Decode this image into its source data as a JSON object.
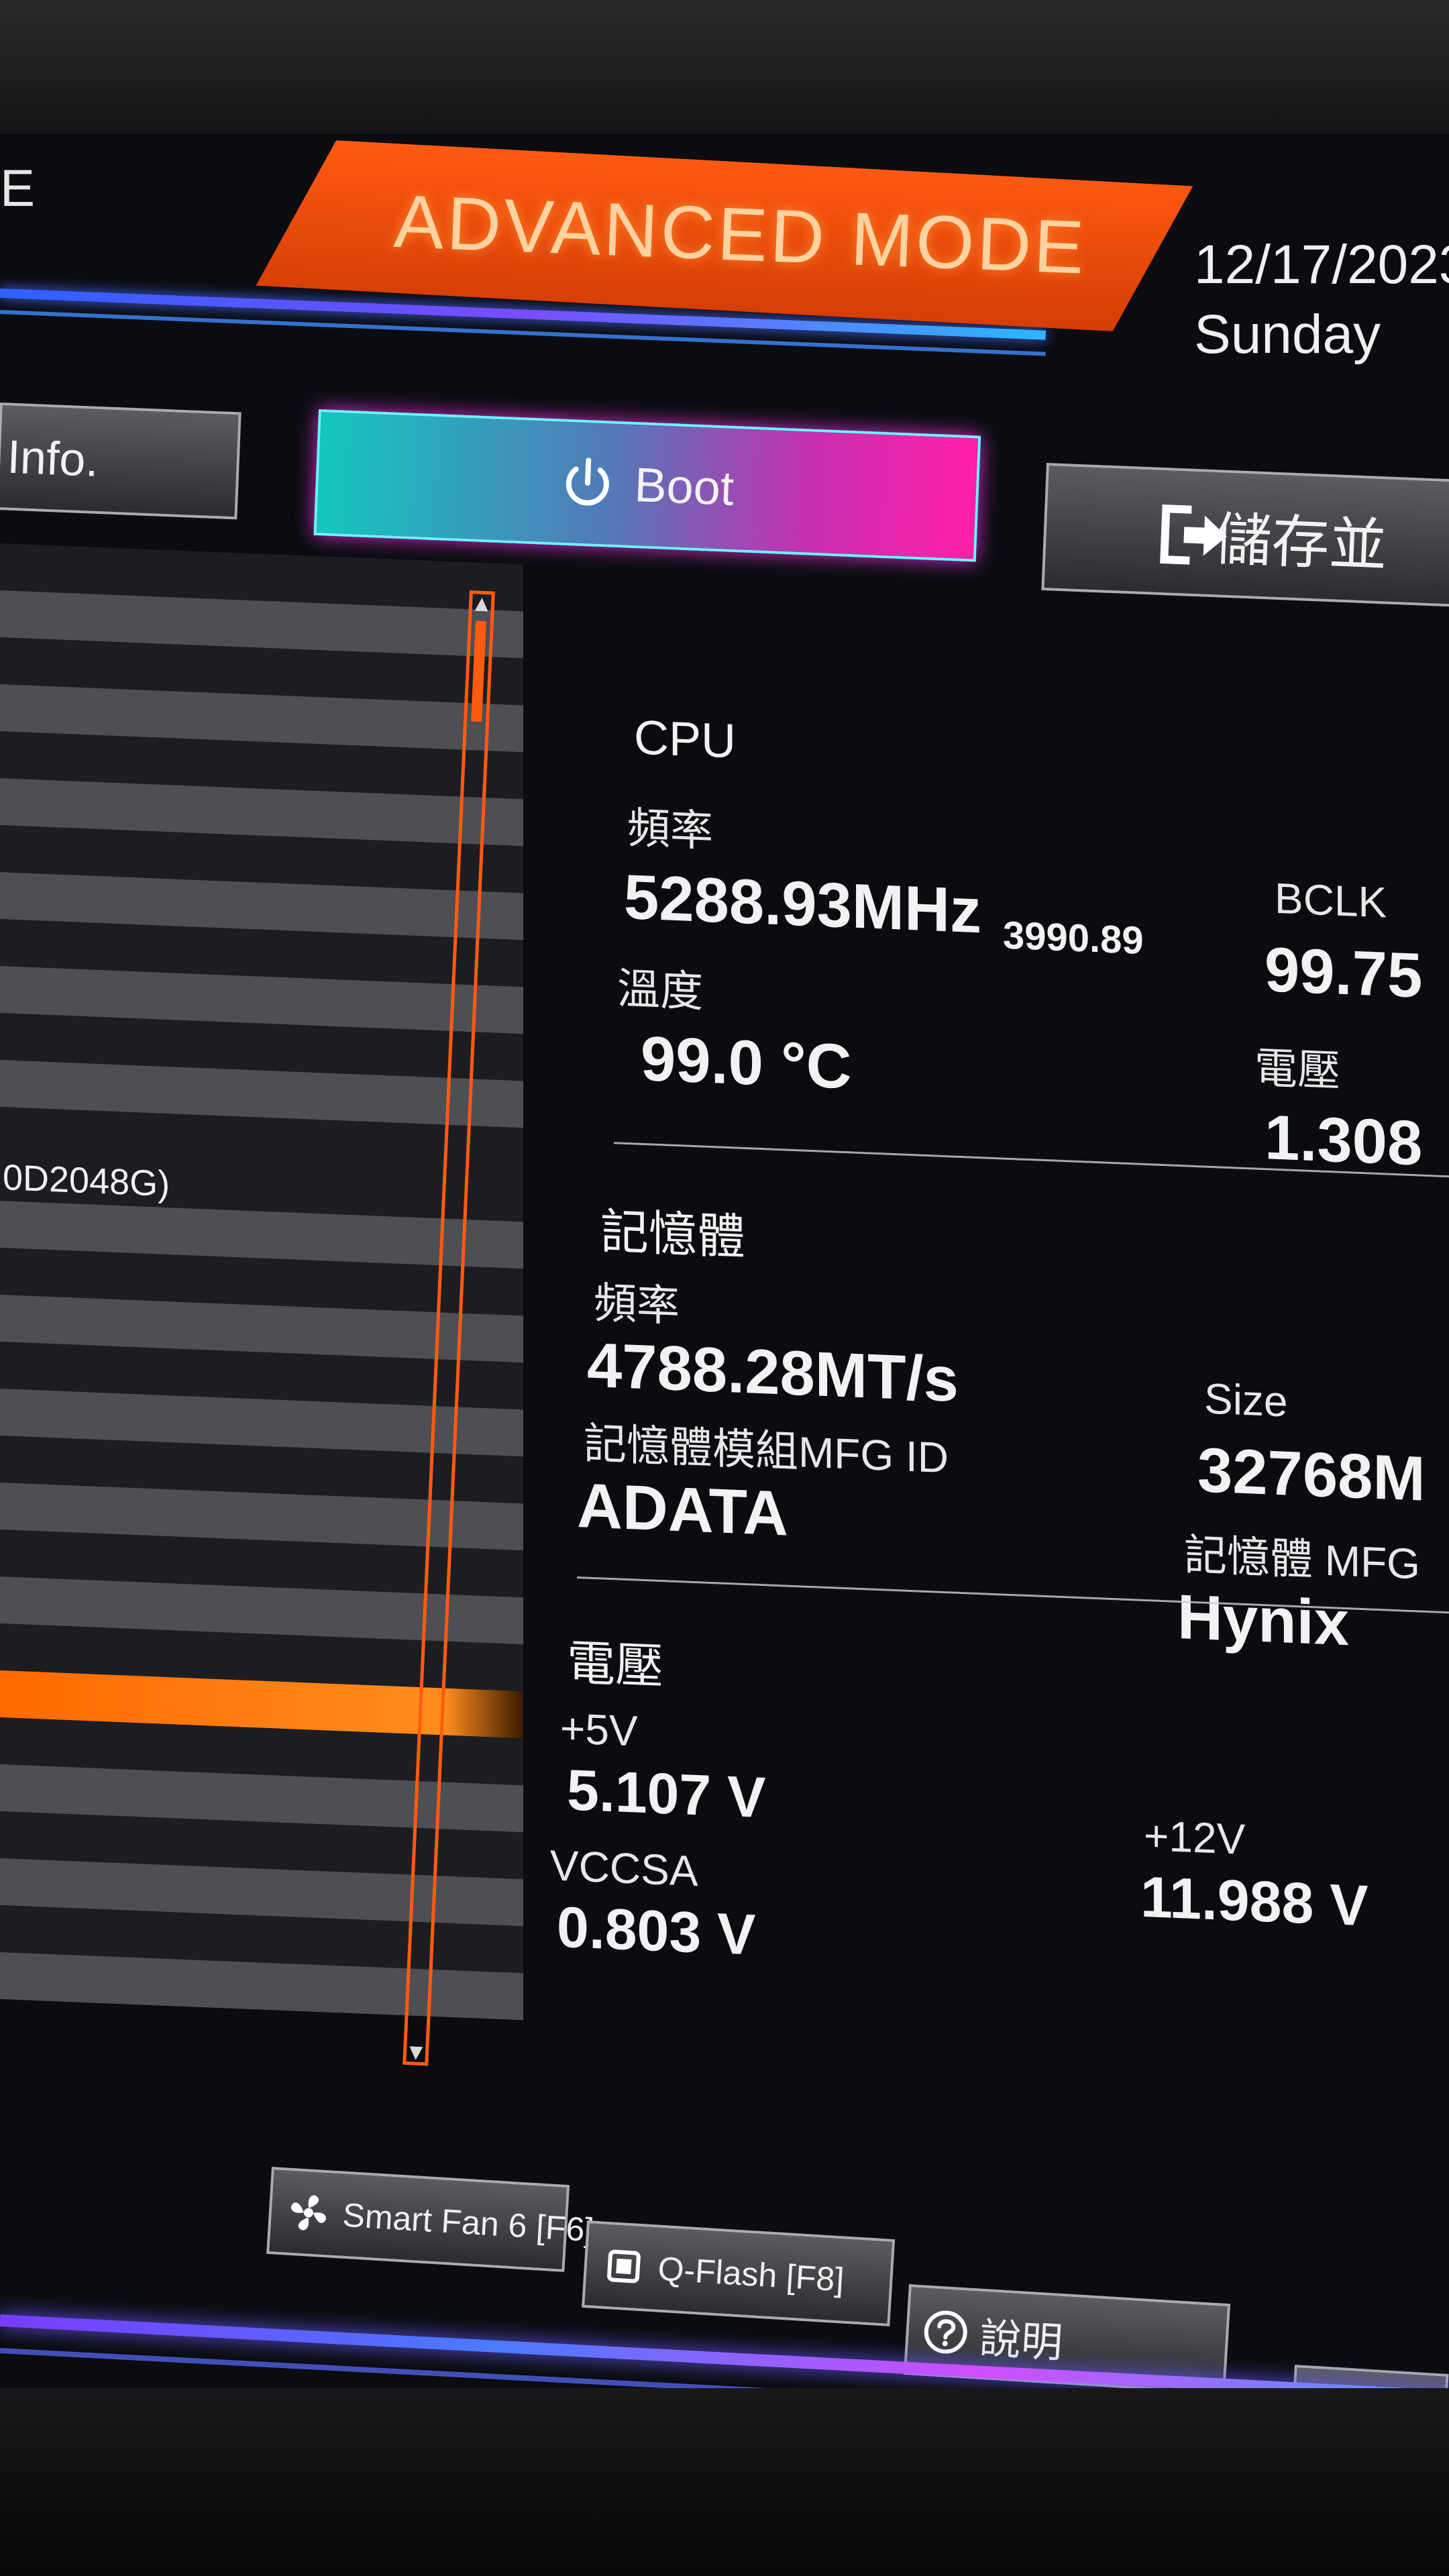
{
  "header": {
    "mode_letter": "E",
    "mode_title": "ADVANCED MODE",
    "date": "12/17/2023",
    "weekday": "Sunday"
  },
  "tabs": {
    "info": "Info.",
    "boot": "Boot",
    "save_exit": "儲存並"
  },
  "list": {
    "visible_item": "0D2048G)"
  },
  "cpu": {
    "heading": "CPU",
    "freq_label": "頻率",
    "freq_value": "5288.93MHz",
    "freq_secondary": "3990.89",
    "temp_label": "溫度",
    "temp_value": "99.0 °C",
    "bclk_label": "BCLK",
    "bclk_value": "99.75",
    "voltage_label": "電壓",
    "voltage_value": "1.308"
  },
  "memory": {
    "heading": "記憶體",
    "freq_label": "頻率",
    "freq_value": "4788.28MT/s",
    "size_label": "Size",
    "size_value": "32768M",
    "module_mfg_label": "記憶體模組MFG ID",
    "module_mfg_value": "ADATA",
    "chip_mfg_label": "記憶體 MFG",
    "chip_mfg_value": "Hynix"
  },
  "voltage": {
    "heading": "電壓",
    "v5_label": "+5V",
    "v5_value": "5.107 V",
    "v12_label": "+12V",
    "v12_value": "11.988 V",
    "vccsa_label": "VCCSA",
    "vccsa_value": "0.803 V"
  },
  "footer": {
    "smart_fan": "Smart Fan 6 [F6]",
    "qflash": "Q-Flash [F8]",
    "help": "說明"
  },
  "icons": {
    "power": "power-icon",
    "exit": "exit-icon",
    "fan": "fan-icon",
    "chip": "chip-icon",
    "help": "help-icon",
    "search": "search-icon"
  },
  "colors": {
    "accent_orange": "#ff5a12",
    "boot_cyan": "#13c7c0",
    "boot_magenta": "#ff1fa8"
  }
}
